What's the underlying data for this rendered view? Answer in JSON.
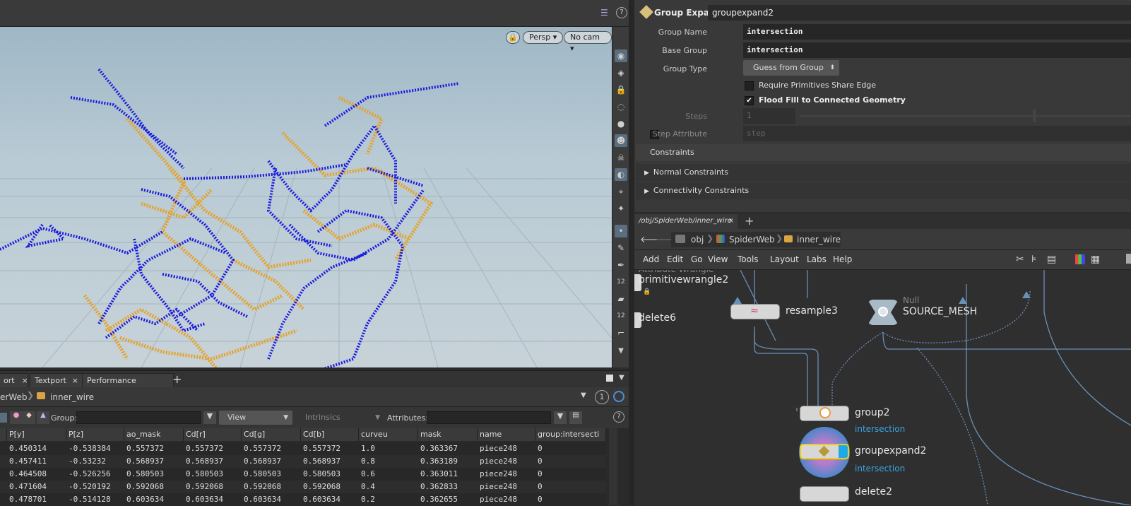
{
  "viewport": {
    "persp_label": "Persp",
    "cam_label": "No cam"
  },
  "bottom_tabs": [
    {
      "label": "ort"
    },
    {
      "label": "Textport"
    },
    {
      "label": "Performance Monitor"
    }
  ],
  "sheet_path": {
    "segments": [
      "erWeb",
      "inner_wire"
    ],
    "badge": "1"
  },
  "sheet_toolbar": {
    "group_label": "Group:",
    "view_label": "View",
    "intrinsics_label": "Intrinsics",
    "attributes_label": "Attributes:"
  },
  "spreadsheet": {
    "columns": [
      "P[y]",
      "P[z]",
      "ao_mask",
      "Cd[r]",
      "Cd[g]",
      "Cd[b]",
      "curveu",
      "mask",
      "name",
      "group:intersecti"
    ],
    "rows": [
      [
        "0.450314",
        "-0.538384",
        "0.557372",
        "0.557372",
        "0.557372",
        "0.557372",
        "1.0",
        "0.363367",
        "piece248",
        "0"
      ],
      [
        "0.457411",
        "-0.53232",
        "0.568937",
        "0.568937",
        "0.568937",
        "0.568937",
        "0.8",
        "0.363189",
        "piece248",
        "0"
      ],
      [
        "0.464508",
        "-0.526256",
        "0.580503",
        "0.580503",
        "0.580503",
        "0.580503",
        "0.6",
        "0.363011",
        "piece248",
        "0"
      ],
      [
        "0.471604",
        "-0.520192",
        "0.592068",
        "0.592068",
        "0.592068",
        "0.592068",
        "0.4",
        "0.362833",
        "piece248",
        "0"
      ],
      [
        "0.478701",
        "-0.514128",
        "0.603634",
        "0.603634",
        "0.603634",
        "0.603634",
        "0.2",
        "0.362655",
        "piece248",
        "0"
      ]
    ]
  },
  "params": {
    "node_type": "Group Expand",
    "node_name": "groupexpand2",
    "group_name_label": "Group Name",
    "group_name_value": "intersection",
    "base_group_label": "Base Group",
    "base_group_value": "intersection",
    "group_type_label": "Group Type",
    "group_type_value": "Guess from Group",
    "require_label": "Require Primitives Share Edge",
    "flood_label": "Flood Fill to Connected Geometry",
    "steps_label": "Steps",
    "steps_value": "1",
    "step_attr_label": "Step Attribute",
    "step_attr_value": "step",
    "constraints_label": "Constraints",
    "normal_constraints": "Normal Constraints",
    "connectivity_constraints": "Connectivity Constraints"
  },
  "network": {
    "tab_label": "/obj/SpiderWeb/inner_wire",
    "path": [
      "obj",
      "SpiderWeb",
      "inner_wire"
    ],
    "menu": [
      "Add",
      "Edit",
      "Go",
      "View",
      "Tools",
      "Layout",
      "Labs",
      "Help"
    ],
    "nodes": {
      "wrangle_type": "Attribute Wrangle",
      "wrangle_name": "primitivewrangle2",
      "delete6": "delete6",
      "resample": "resample3",
      "null_type": "Null",
      "null_name": "SOURCE_MESH",
      "group2": "group2",
      "group2_sub": "intersection",
      "groupexpand": "groupexpand2",
      "groupexpand_sub": "intersection",
      "delete_partial": "delete2"
    }
  },
  "colors": {
    "wire_a": "#1a1adc",
    "wire_b": "#e8a021",
    "accent": "#39a3e6"
  }
}
